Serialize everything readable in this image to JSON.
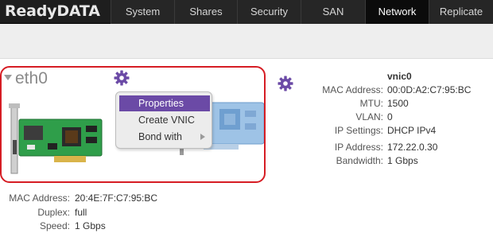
{
  "app": {
    "logo": "ReadyDATA"
  },
  "nav": {
    "tabs": [
      {
        "label": "System"
      },
      {
        "label": "Shares"
      },
      {
        "label": "Security"
      },
      {
        "label": "SAN"
      },
      {
        "label": "Network",
        "active": true
      },
      {
        "label": "Replicate"
      }
    ]
  },
  "interface": {
    "name": "eth0",
    "details": [
      {
        "label": "MAC Address:",
        "value": "20:4E:7F:C7:95:BC"
      },
      {
        "label": "Duplex:",
        "value": "full"
      },
      {
        "label": "Speed:",
        "value": "1 Gbps"
      }
    ]
  },
  "context_menu": {
    "items": [
      {
        "label": "Properties",
        "highlighted": true
      },
      {
        "label": "Create VNIC"
      },
      {
        "label": "Bond with",
        "has_submenu": true
      }
    ]
  },
  "vnic": {
    "title": "vnic0",
    "details": [
      {
        "label": "MAC Address:",
        "value": "00:0D:A2:C7:95:BC"
      },
      {
        "label": "MTU:",
        "value": "1500"
      },
      {
        "label": "VLAN:",
        "value": "0"
      },
      {
        "label": "IP Settings:",
        "value": "DHCP IPv4"
      },
      {
        "label": "IP Address:",
        "value": "172.22.0.30"
      },
      {
        "label": "Bandwidth:",
        "value": "1 Gbps"
      }
    ]
  },
  "colors": {
    "accent_purple": "#6b4aa6",
    "selection_border": "#d61d24",
    "nav_background": "#1e1e1e"
  },
  "icons": {
    "gear": "gear-icon",
    "caret": "caret-down-icon",
    "submenu": "chevron-right-icon"
  }
}
